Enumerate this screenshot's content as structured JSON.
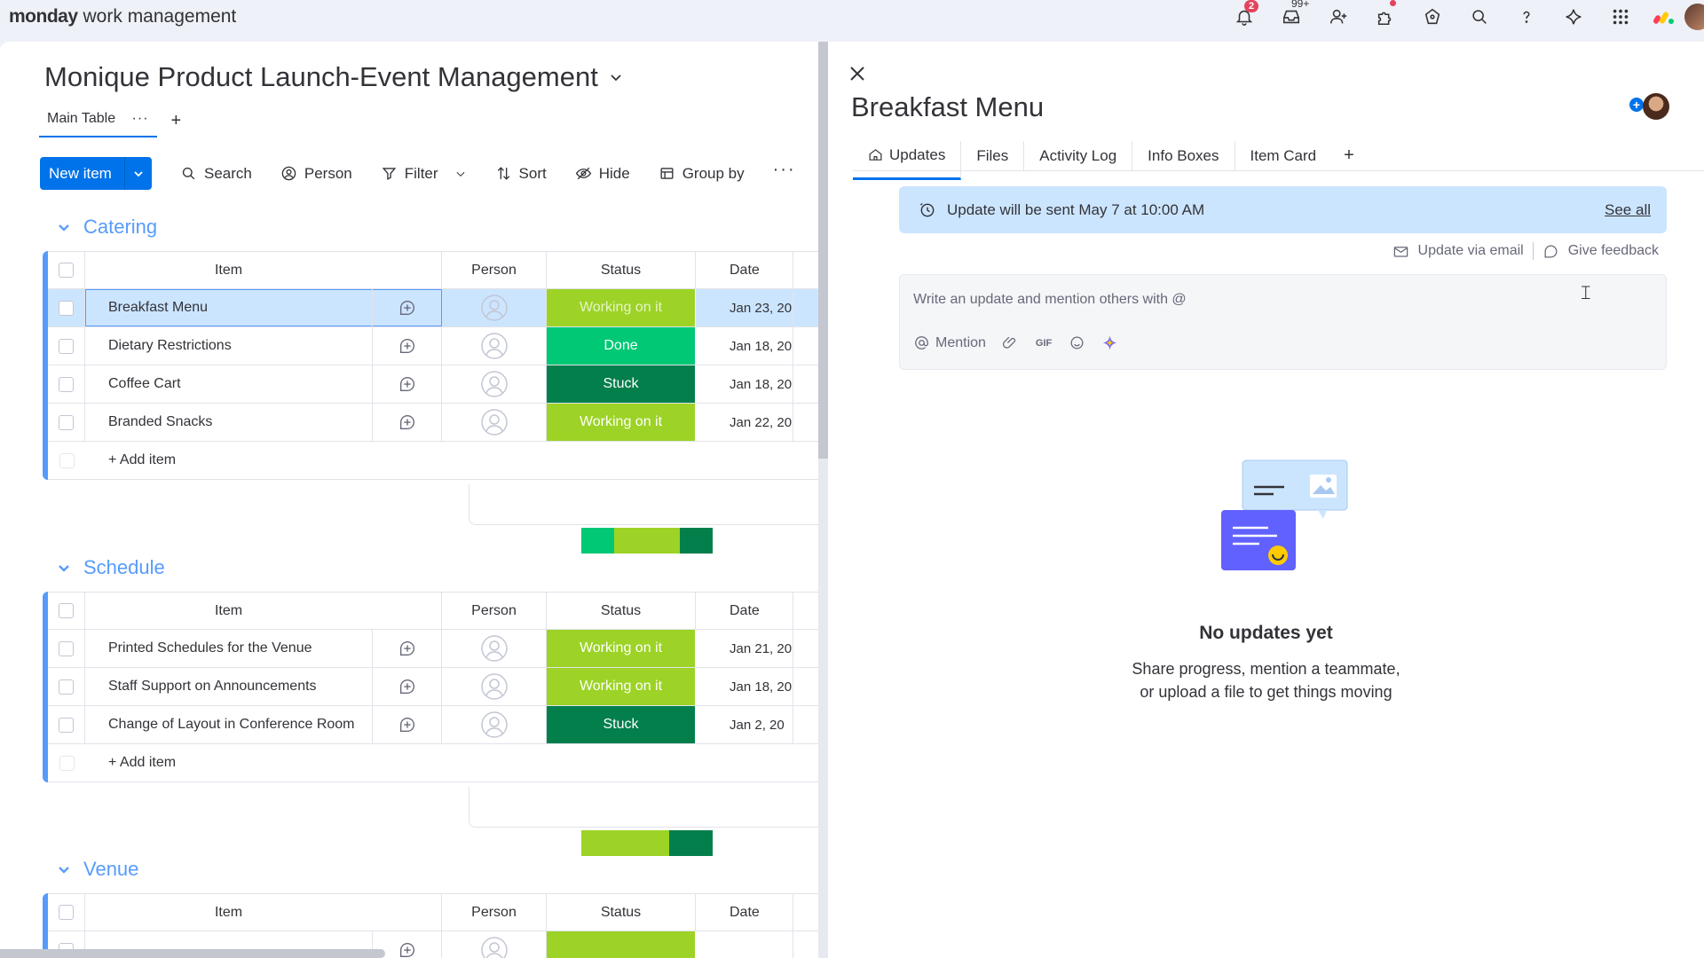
{
  "topbar": {
    "brand_bold": "monday",
    "brand_rest": "work management",
    "notif_count": "2",
    "inbox_count": "99+"
  },
  "board": {
    "title": "Monique Product Launch-Event Management",
    "views": [
      {
        "label": "Main Table"
      }
    ],
    "toolbar": {
      "new_item": "New item",
      "search": "Search",
      "person": "Person",
      "filter": "Filter",
      "sort": "Sort",
      "hide": "Hide",
      "group_by": "Group by"
    },
    "columns": {
      "item": "Item",
      "person": "Person",
      "status": "Status",
      "date": "Date"
    },
    "add_item": "+ Add item",
    "groups": [
      {
        "title": "Catering",
        "rows": [
          {
            "item": "Breakfast Menu",
            "status": "Working on it",
            "status_color": "#9cd326",
            "date": "Jan 23, 20",
            "selected": true
          },
          {
            "item": "Dietary Restrictions",
            "status": "Done",
            "status_color": "#00c875",
            "date": "Jan 18, 20"
          },
          {
            "item": "Coffee Cart",
            "status": "Stuck",
            "status_color": "#037f4c",
            "date": "Jan 18, 20"
          },
          {
            "item": "Branded Snacks",
            "status": "Working on it",
            "status_color": "#9cd326",
            "date": "Jan 22, 20"
          }
        ],
        "summary": [
          {
            "color": "#00c875",
            "fraction": 0.25
          },
          {
            "color": "#9cd326",
            "fraction": 0.5
          },
          {
            "color": "#037f4c",
            "fraction": 0.25
          }
        ]
      },
      {
        "title": "Schedule",
        "rows": [
          {
            "item": "Printed Schedules for the Venue",
            "status": "Working on it",
            "status_color": "#9cd326",
            "date": "Jan 21, 20"
          },
          {
            "item": "Staff Support on Announcements",
            "status": "Working on it",
            "status_color": "#9cd326",
            "date": "Jan 18, 20"
          },
          {
            "item": "Change of Layout in Conference Room",
            "status": "Stuck",
            "status_color": "#037f4c",
            "date": "Jan 2, 20"
          }
        ],
        "summary": [
          {
            "color": "#9cd326",
            "fraction": 0.667
          },
          {
            "color": "#037f4c",
            "fraction": 0.333
          }
        ]
      },
      {
        "title": "Venue",
        "rows": []
      }
    ]
  },
  "panel": {
    "title": "Breakfast Menu",
    "tabs": [
      {
        "label": "Updates",
        "active": true
      },
      {
        "label": "Files"
      },
      {
        "label": "Activity Log"
      },
      {
        "label": "Info Boxes"
      },
      {
        "label": "Item Card"
      }
    ],
    "tab_add": "+",
    "banner": {
      "text": "Update will be sent May 7 at 10:00 AM",
      "link": "See all"
    },
    "update_via_email": "Update via email",
    "give_feedback": "Give feedback",
    "editor": {
      "placeholder": "Write an update and mention others with @",
      "mention": "Mention",
      "gif": "GIF"
    },
    "empty": {
      "heading": "No updates yet",
      "line1": "Share progress, mention a teammate,",
      "line2": "or upload a file to get things moving"
    }
  },
  "colors": {
    "accent": "#0073ea",
    "group": "#579bfc",
    "working": "#9cd326",
    "done": "#00c875",
    "stuck": "#037f4c",
    "selected_row": "#cce5ff"
  }
}
